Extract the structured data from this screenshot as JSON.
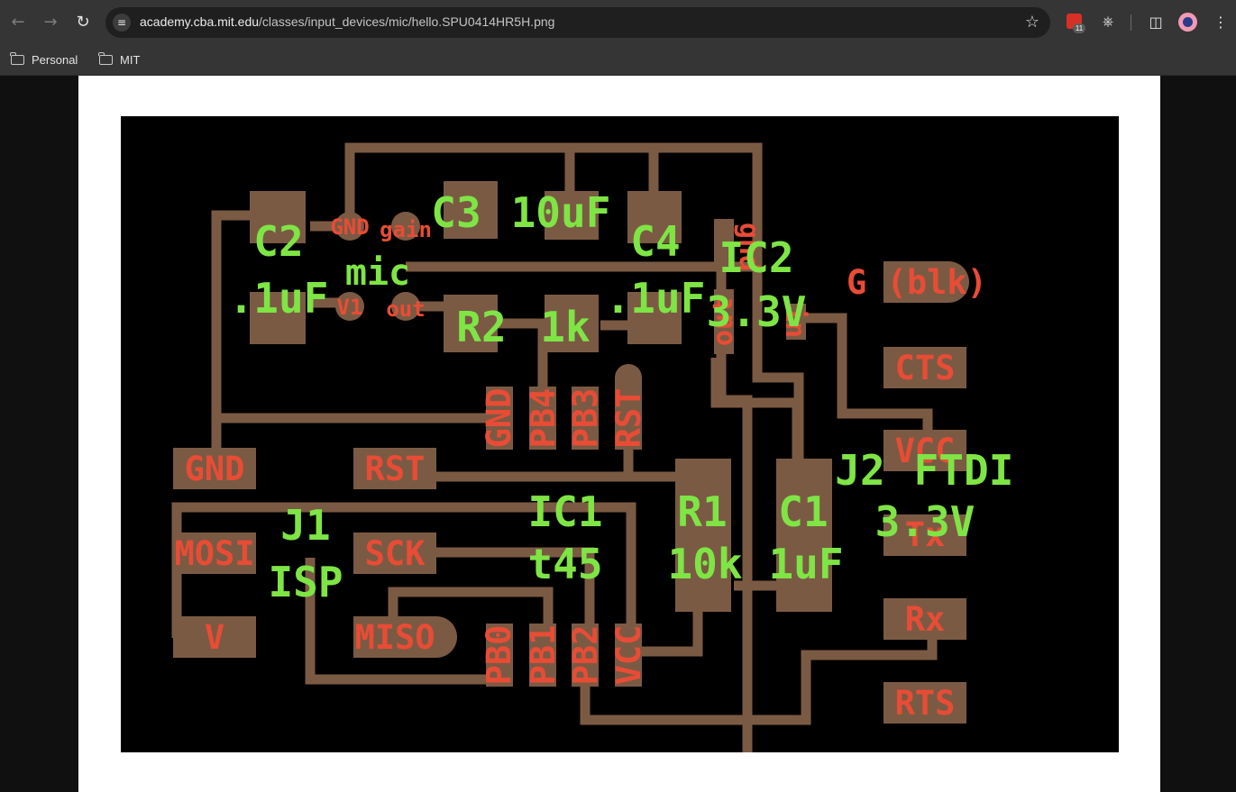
{
  "browser": {
    "url_host": "academy.cba.mit.edu",
    "url_path": "/classes/input_devices/mic/hello.SPU0414HR5H.png",
    "calendar_badge": "11",
    "icons": [
      "back-arrow-icon",
      "forward-arrow-icon",
      "reload-icon",
      "site-info-icon",
      "bookmark-star-icon",
      "google-calendar-icon",
      "extensions-puzzle-icon",
      "side-panel-icon",
      "profile-avatar-icon",
      "menu-kebab-icon"
    ],
    "bookmarks": [
      {
        "label": "Personal",
        "icon": "folder-icon"
      },
      {
        "label": "MIT",
        "icon": "folder-icon"
      }
    ]
  },
  "pcb": {
    "colors": {
      "background": "#000000",
      "copper": "#7b5a44",
      "pad_label": "#e84c35",
      "component_label": "#7ee545"
    },
    "pad_labels": {
      "gnd_left": "GND",
      "rst_pad": "RST",
      "mosi": "MOSI",
      "sck": "SCK",
      "miso": "MISO",
      "v": "V",
      "cts": "CTS",
      "vcc_pad": "VCC",
      "tx": "Tx",
      "rx": "Rx",
      "rts": "RTS",
      "g_blk": "G (blk)",
      "mic_gnd": "GND",
      "mic_gain": "gain",
      "mic_v1": "V1",
      "mic_out": "out",
      "pb0": "PB0",
      "pb1": "PB1",
      "pb2": "PB2",
      "vcc_ic": "VCC",
      "gnd_ic": "GND",
      "pb4": "PB4",
      "pb3": "PB3",
      "rst_ic": "RST",
      "reg_gnd": "gnd",
      "reg_out": "out",
      "reg_in": "in"
    },
    "component_labels": {
      "c2": "C2",
      "c2_val": ".1uF",
      "c3": "C3",
      "c3_val": "10uF",
      "c4": "C4",
      "c4_val": ".1uF",
      "mic": "mic",
      "r2": "R2",
      "r2_val": "1k",
      "ic2": "IC2",
      "ic2_val": "3.3V",
      "j1": "J1",
      "j1_val": "ISP",
      "ic1": "IC1",
      "ic1_val": "t45",
      "r1": "R1",
      "r1_val": "10k",
      "c1": "C1",
      "c1_val": "1uF",
      "j2": "J2",
      "j2_val": "FTDI",
      "j2_volt": "3.3V"
    }
  }
}
